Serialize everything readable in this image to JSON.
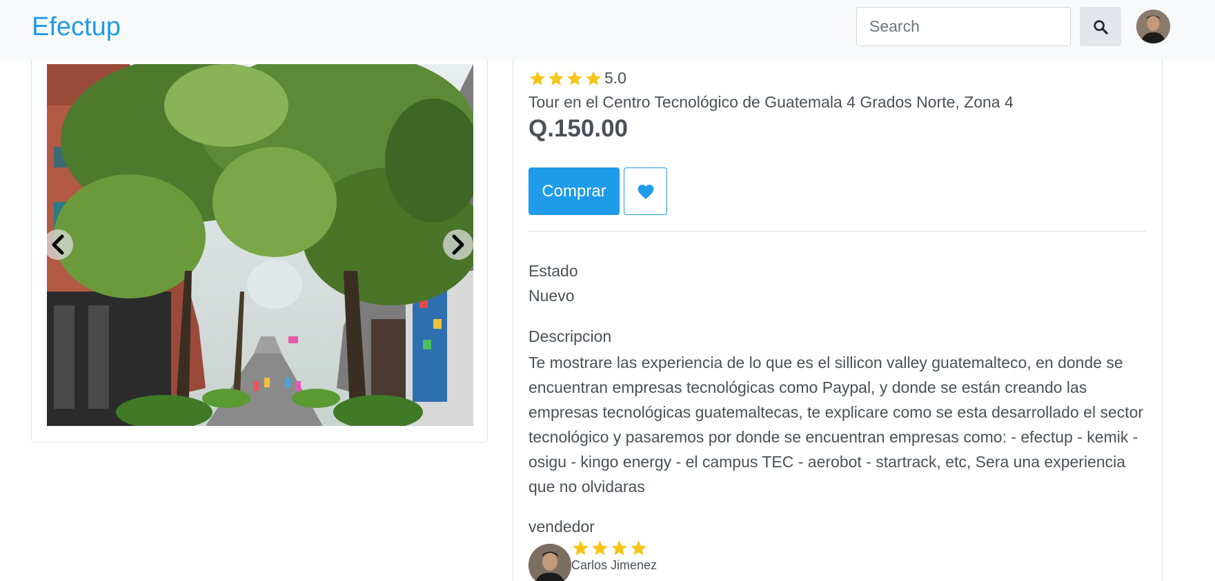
{
  "navbar": {
    "brand": "Efectup",
    "search_placeholder": "Search",
    "accent_color": "#1e9be9"
  },
  "product": {
    "rating": "5.0",
    "rating_stars": 4,
    "title": "Tour en el Centro Tecnológico de Guatemala 4 Grados Norte, Zona 4",
    "price": "Q.150.00",
    "buy_label": "Comprar",
    "estado_label": "Estado",
    "estado_value": "Nuevo",
    "description_label": "Descripcion",
    "description": "Te mostrare las experiencia de lo que es el sillicon valley guatemalteco, en donde se encuentran empresas tecnológicas como Paypal, y donde se están creando las empresas tecnológicas guatemaltecas, te explicare como se esta desarrollado el sector tecnológico y pasaremos por donde se encuentran empresas como: - efectup - kemik - osigu - kingo energy - el campus TEC - aerobot - startrack, etc, Sera una experiencia que no olvidaras"
  },
  "seller": {
    "section_label": "vendedor",
    "name": "Carlos Jimenez",
    "stars": 4
  },
  "icons": {
    "search": "search-icon",
    "favorite": "heart-icon",
    "prev": "chevron-left-icon",
    "next": "chevron-right-icon",
    "star": "star-icon"
  },
  "colors": {
    "star": "#f5c518",
    "primary": "#1e9be9",
    "navbar_bg": "#f8f9fa"
  }
}
